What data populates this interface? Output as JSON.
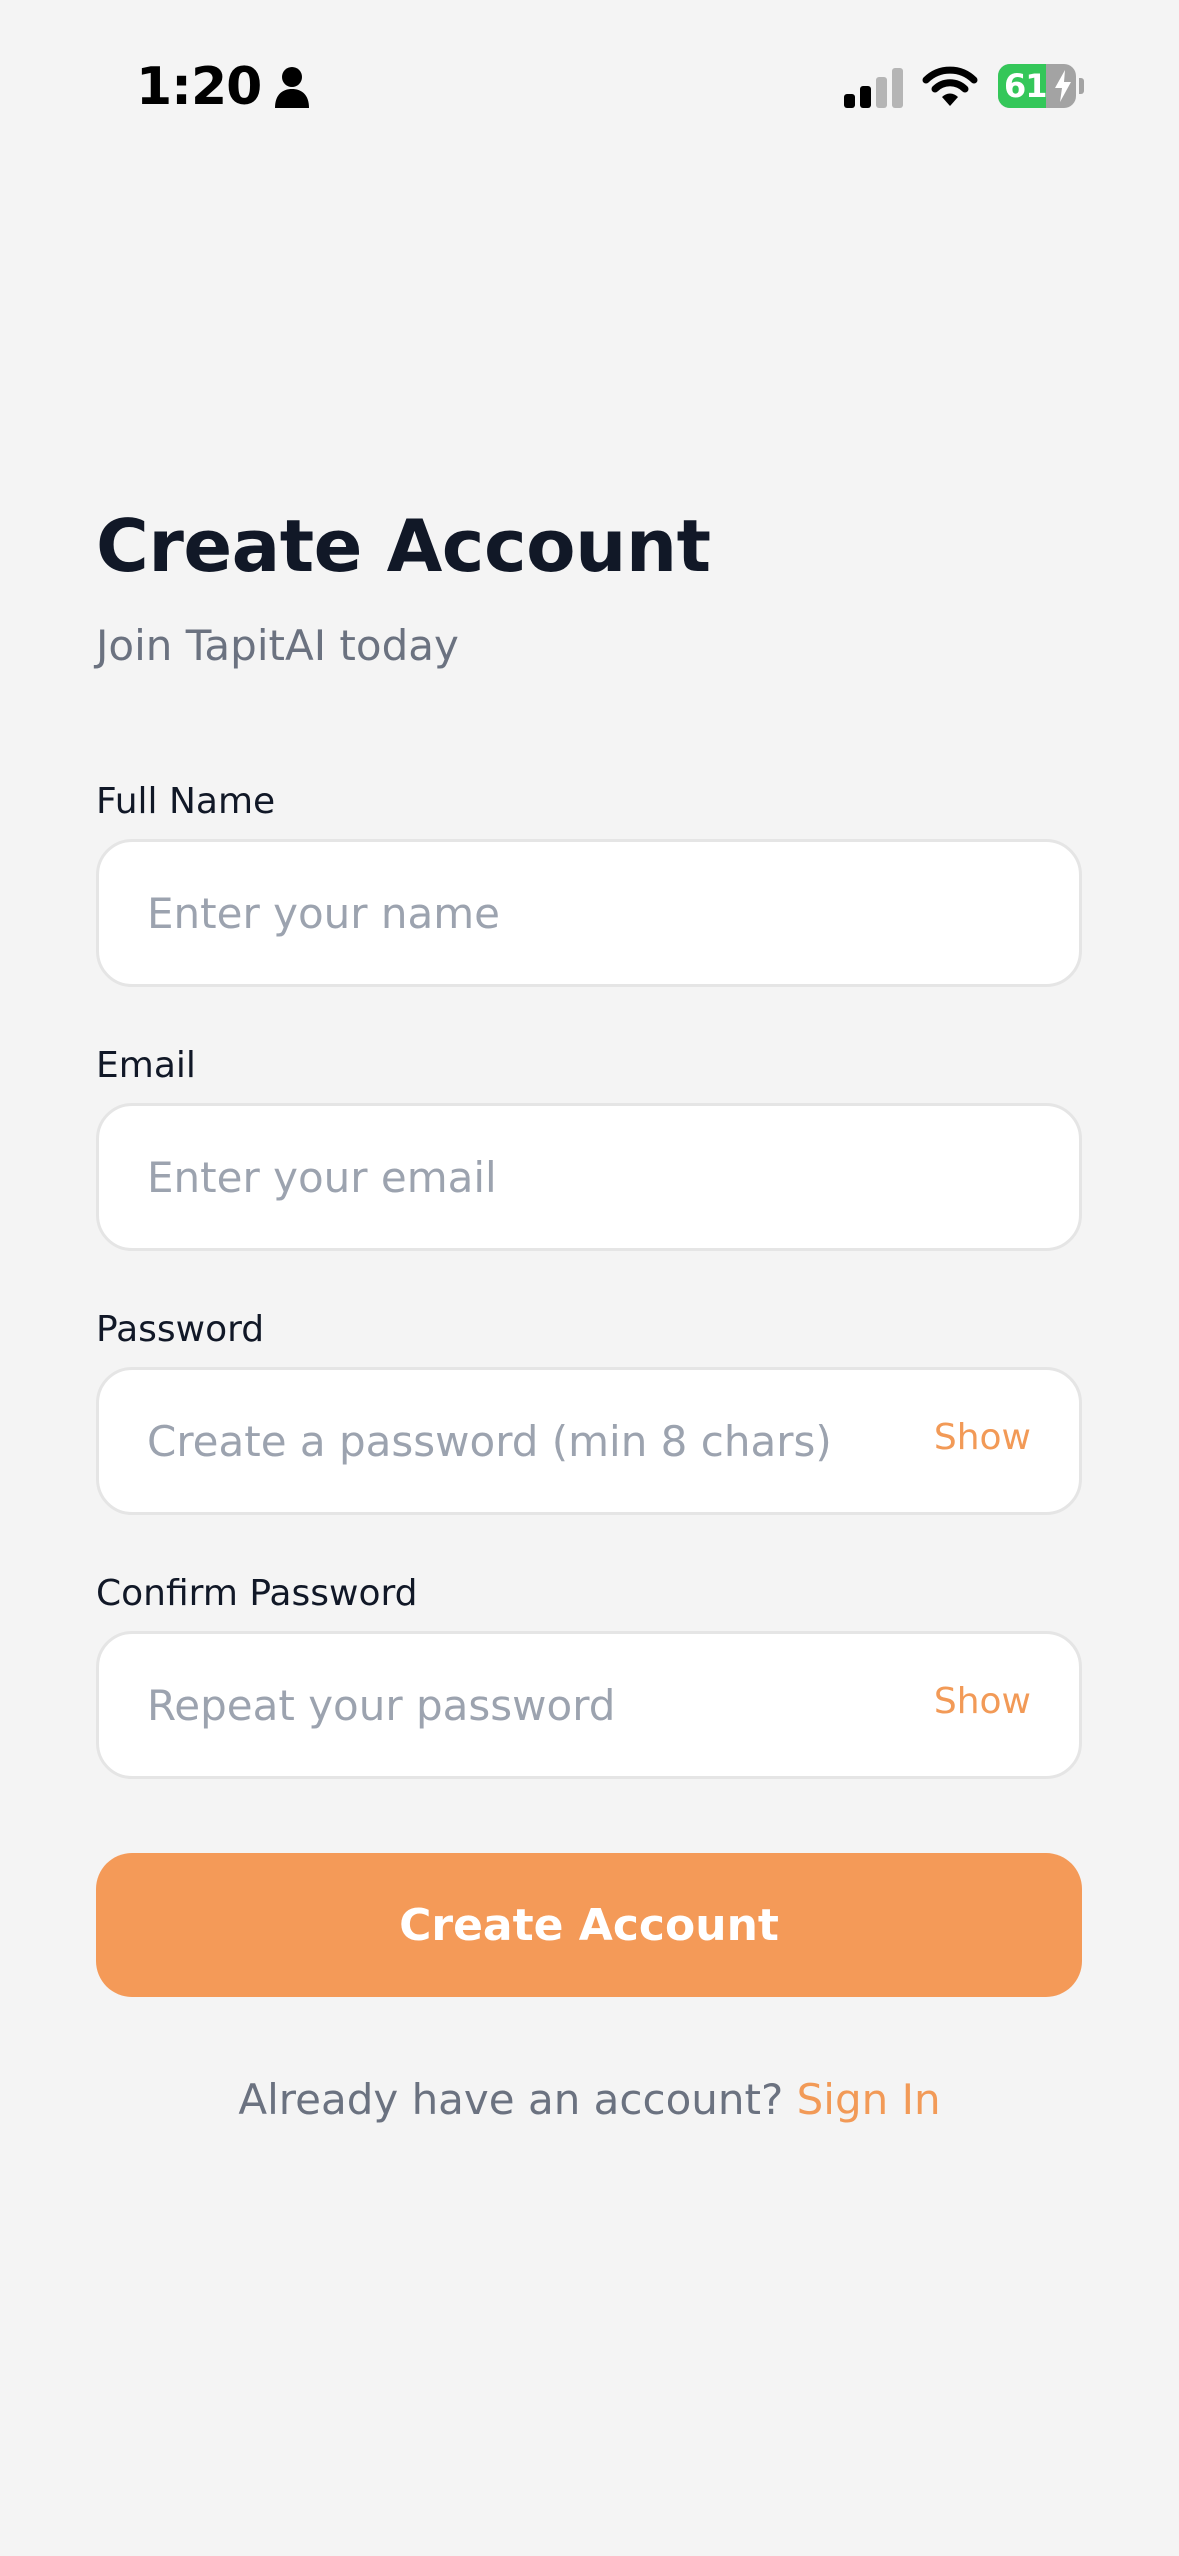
{
  "status_bar": {
    "time": "1:20",
    "battery_level": "61",
    "battery_fraction": 0.61,
    "icons": [
      "person-icon",
      "signal-icon",
      "wifi-icon",
      "battery-icon",
      "bolt-icon"
    ]
  },
  "header": {
    "title": "Create Account",
    "subtitle": "Join TapitAI today"
  },
  "form": {
    "full_name": {
      "label": "Full Name",
      "placeholder": "Enter your name",
      "value": ""
    },
    "email": {
      "label": "Email",
      "placeholder": "Enter your email",
      "value": ""
    },
    "password": {
      "label": "Password",
      "placeholder": "Create a password (min 8 chars)",
      "value": "",
      "toggle_label": "Show"
    },
    "confirm_password": {
      "label": "Confirm Password",
      "placeholder": "Repeat your password",
      "value": "",
      "toggle_label": "Show"
    },
    "submit_label": "Create Account"
  },
  "footer": {
    "prompt": "Already have an account?",
    "link_label": "Sign In"
  },
  "colors": {
    "background": "#f4f4f4",
    "accent": "#f49a58",
    "title_text": "#111827",
    "muted_text": "#6b7280",
    "placeholder_text": "#9ca3af",
    "battery_green": "#34c759"
  }
}
